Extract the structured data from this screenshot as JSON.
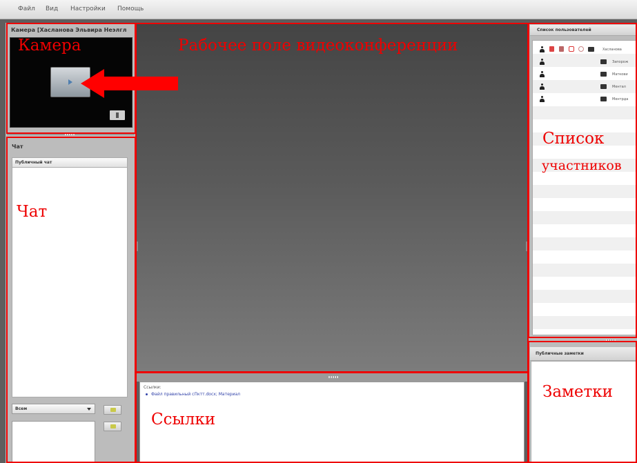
{
  "menu": {
    "items": [
      "Файл",
      "Вид",
      "Настройки",
      "Помощь"
    ]
  },
  "camera": {
    "title": "Камера [Хасланова Эльвира Неэлгл"
  },
  "chat": {
    "title": "Чат",
    "tab": "Публичный чат",
    "select_value": "Всем"
  },
  "links": {
    "caption": "Ссылки:",
    "items": [
      "Файл правильный сПктт.docx; Материал"
    ]
  },
  "users": {
    "title": "Список пользователей",
    "names": [
      "Хасланова",
      "Запорож",
      "Маткови",
      "Ментал",
      "Ментрда"
    ]
  },
  "notes": {
    "title": "Публичные заметки"
  },
  "annotations": {
    "camera": "Камера",
    "workspace": "Рабочее поле видеоконференции",
    "chat": "Чат",
    "users_line1": "Список",
    "users_line2": "участников",
    "links": "Ссылки",
    "notes": "Заметки",
    "color": "#ee0000"
  },
  "icons": [
    "play-icon",
    "download-icon",
    "person-icon",
    "monitor-icon",
    "chevron-down-icon",
    "send-icon"
  ]
}
